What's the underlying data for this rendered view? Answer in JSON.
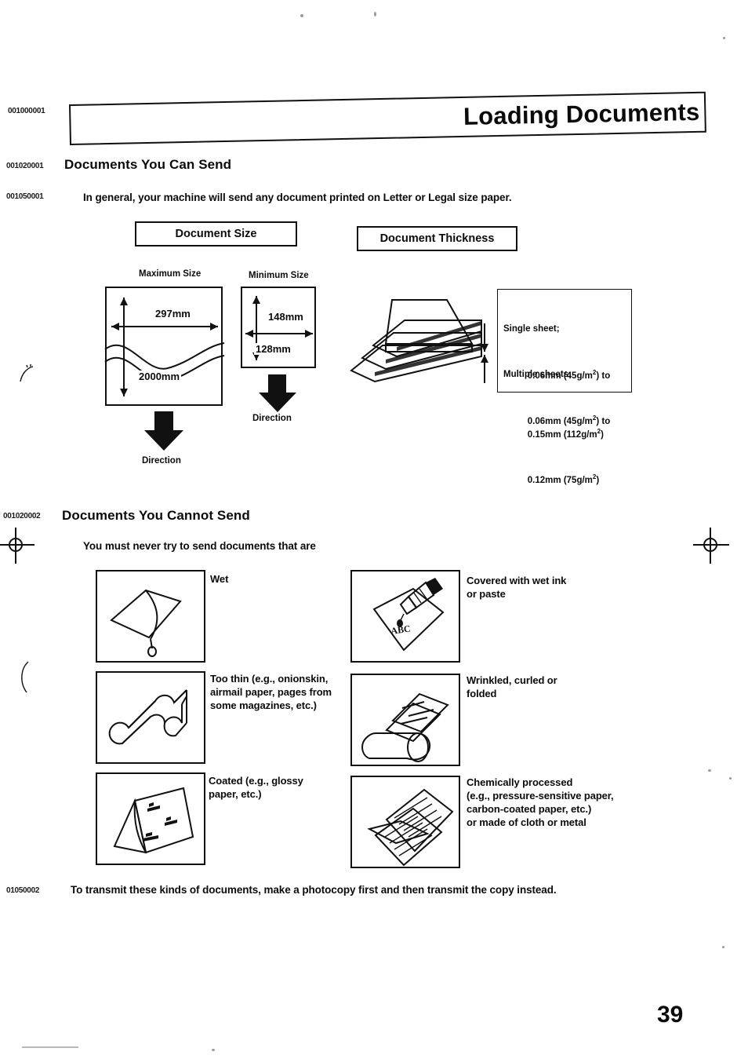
{
  "page": {
    "number": "39",
    "title": "Loading Documents"
  },
  "margin_codes": {
    "title": "001000001",
    "section_can_send": "001020001",
    "intro_paragraph": "001050001",
    "section_cannot_send": "001020002",
    "closing_paragraph": "01050002"
  },
  "sections": {
    "can_send": {
      "heading": "Documents You Can Send",
      "intro": "In general, your machine will send any document printed on Letter or Legal size paper."
    },
    "cannot_send": {
      "heading": "Documents You Cannot Send",
      "intro": "You must never try to send documents that are",
      "closing": "To transmit these kinds of documents, make a photocopy first and then transmit the copy instead."
    }
  },
  "document_size": {
    "panel_label": "Document Size",
    "maximum": {
      "label": "Maximum Size",
      "width": "297mm",
      "length": "2000mm",
      "direction": "Direction"
    },
    "minimum": {
      "label": "Minimum Size",
      "width": "148mm",
      "length": "128mm",
      "direction": "Direction"
    }
  },
  "document_thickness": {
    "panel_label": "Document Thickness",
    "specs": [
      {
        "title": "Single sheet;",
        "line1": "0.06mm (45g/m2) to",
        "line2": "0.15mm (112g/m2)",
        "min_mm": "0.06mm",
        "min_gsm": "45g/m2",
        "max_mm": "0.15mm",
        "max_gsm": "112g/m2"
      },
      {
        "title": "Multiple sheets;",
        "line1": "0.06mm (45g/m2) to",
        "line2": "0.12mm (75g/m2)",
        "min_mm": "0.06mm",
        "min_gsm": "45g/m2",
        "max_mm": "0.12mm",
        "max_gsm": "75g/m2"
      }
    ]
  },
  "cannot_send_items": [
    {
      "id": "wet",
      "icon": "wet-sheet-icon",
      "caption": "Wet"
    },
    {
      "id": "wet-ink",
      "icon": "pen-writing-abc-icon",
      "caption": "Covered with wet ink\nor paste",
      "sheet_text": "ABC"
    },
    {
      "id": "too-thin",
      "icon": "rippled-thin-sheet-icon",
      "caption": "Too thin (e.g., onionskin,\nairmail paper, pages from\nsome magazines, etc.)"
    },
    {
      "id": "wrinkled",
      "icon": "curled-rolled-sheet-icon",
      "caption": "Wrinkled, curled or\nfolded"
    },
    {
      "id": "coated",
      "icon": "glossy-sheet-icon",
      "caption": "Coated (e.g., glossy\npaper, etc.)"
    },
    {
      "id": "chemically-processed",
      "icon": "carbon-form-icon",
      "caption": "Chemically processed\n(e.g., pressure-sensitive paper,\ncarbon-coated paper, etc.)\nor made of cloth or metal"
    }
  ],
  "colors": {
    "ink": "#111111",
    "paper": "#ffffff"
  }
}
